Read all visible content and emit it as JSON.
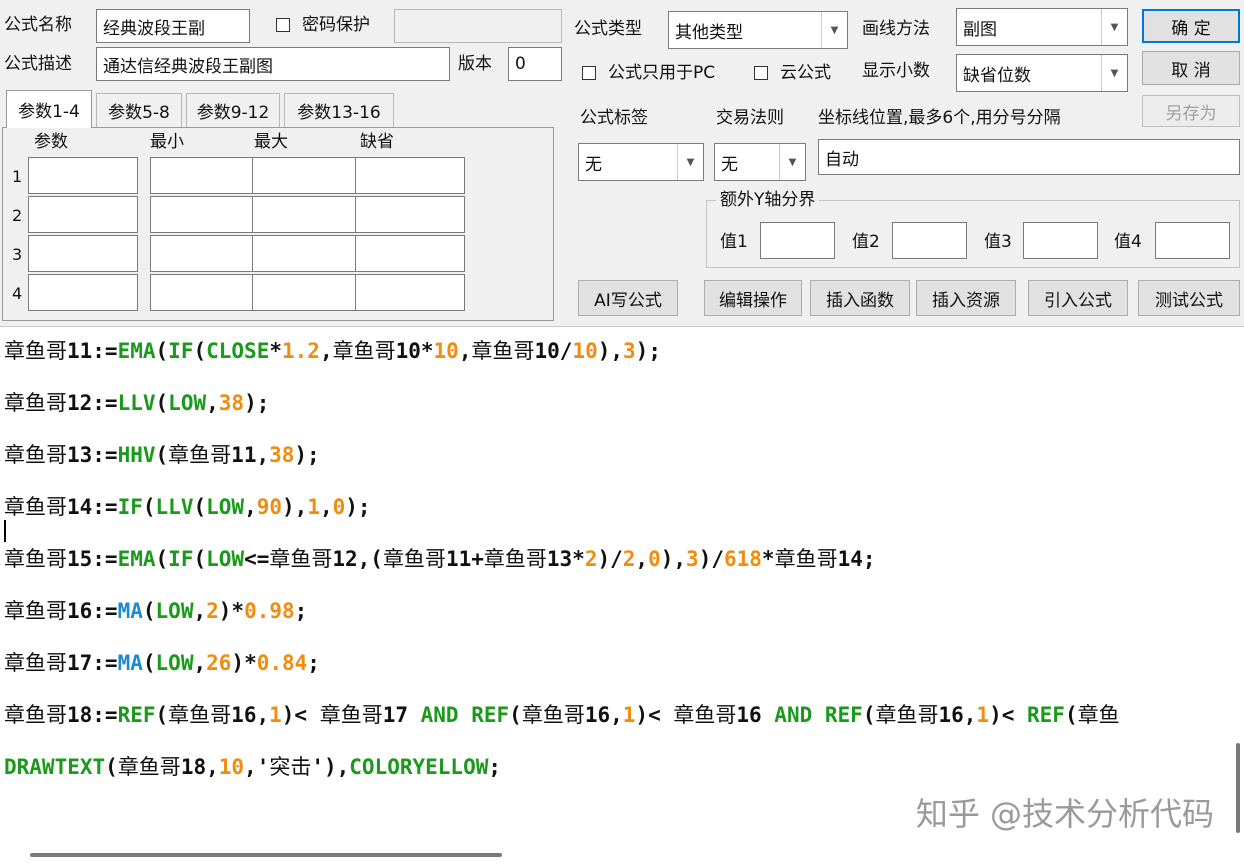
{
  "left": {
    "name_label": "公式名称",
    "name_value": "经典波段王副",
    "password_label": "密码保护",
    "desc_label": "公式描述",
    "desc_value": "通达信经典波段王副图",
    "version_label": "版本",
    "version_value": "0"
  },
  "tabs": [
    {
      "label": "参数1-4"
    },
    {
      "label": "参数5-8"
    },
    {
      "label": "参数9-12"
    },
    {
      "label": "参数13-16"
    }
  ],
  "params": {
    "headers": [
      "参数",
      "最小",
      "最大",
      "缺省"
    ],
    "rows": [
      "1",
      "2",
      "3",
      "4"
    ]
  },
  "right": {
    "type_label": "公式类型",
    "type_value": "其他类型",
    "draw_label": "画线方法",
    "draw_value": "副图",
    "pc_only_label": "公式只用于PC",
    "cloud_label": "云公式",
    "decimal_label": "显示小数",
    "decimal_value": "缺省位数",
    "tag_label": "公式标签",
    "tag_value": "无",
    "rule_label": "交易法则",
    "rule_value": "无",
    "coord_label": "坐标线位置,最多6个,用分号分隔",
    "coord_value": "自动",
    "y_group_label": "额外Y轴分界",
    "y_values": [
      {
        "label": "值1"
      },
      {
        "label": "值2"
      },
      {
        "label": "值3"
      },
      {
        "label": "值4"
      }
    ]
  },
  "buttons": {
    "ok": "确  定",
    "cancel": "取  消",
    "save_as": "另存为",
    "ai": "AI写公式",
    "edit": "编辑操作",
    "insert_func": "插入函数",
    "insert_res": "插入资源",
    "import": "引入公式",
    "test": "测试公式"
  },
  "code_lines": [
    "章鱼哥11:=EMA(IF(CLOSE*1.2,章鱼哥10*10,章鱼哥10/10),3);",
    "章鱼哥12:=LLV(LOW,38);",
    "章鱼哥13:=HHV(章鱼哥11,38);",
    "章鱼哥14:=IF(LLV(LOW,90),1,0);",
    "章鱼哥15:=EMA(IF(LOW<=章鱼哥12,(章鱼哥11+章鱼哥13*2)/2,0),3)/618*章鱼哥14;",
    "章鱼哥16:=MA(LOW,2)*0.98;",
    "章鱼哥17:=MA(LOW,26)*0.84;",
    "章鱼哥18:=REF(章鱼哥16,1)< 章鱼哥17 AND REF(章鱼哥16,1)< 章鱼哥16 AND REF(章鱼哥16,1)< REF(章鱼",
    "DRAWTEXT(章鱼哥18,10,'突击'),COLORYELLOW;"
  ],
  "watermark": "知乎 @技术分析代码"
}
